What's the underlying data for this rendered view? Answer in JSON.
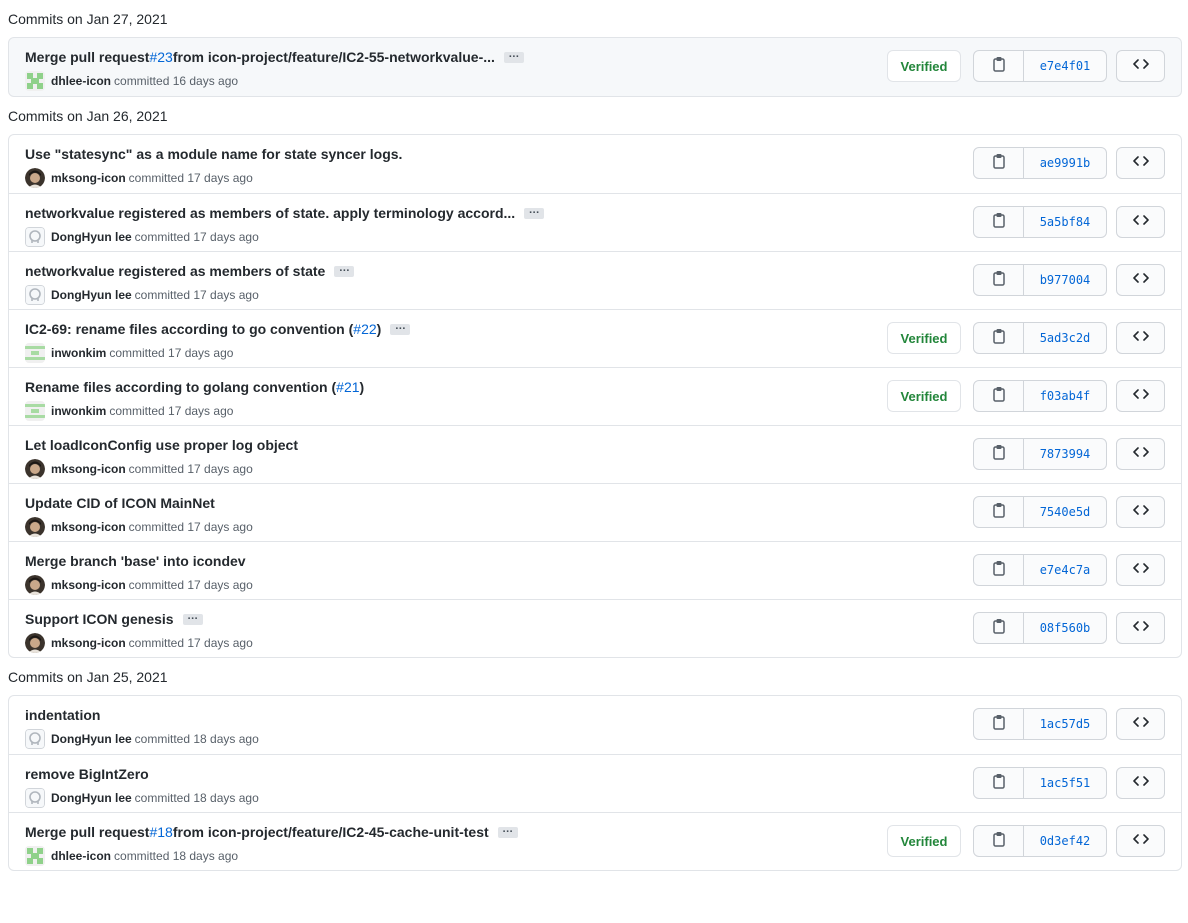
{
  "groups": [
    {
      "title": "Commits on Jan 27, 2021",
      "highlight": true,
      "commits": [
        {
          "pre": "Merge pull request ",
          "link": "#23",
          "post": " from icon-project/feature/IC2-55-networkvalue-...",
          "ellipsis": true,
          "author": "dhlee-icon",
          "avatar": "identicon-green",
          "time": "committed 16 days ago",
          "verified": true,
          "sha": "e7e4f01"
        }
      ]
    },
    {
      "title": "Commits on Jan 26, 2021",
      "highlight": false,
      "commits": [
        {
          "pre": "Use \"statesync\" as a module name for state syncer logs.",
          "link": "",
          "post": "",
          "ellipsis": false,
          "author": "mksong-icon",
          "avatar": "photo",
          "time": "committed 17 days ago",
          "verified": false,
          "sha": "ae9991b"
        },
        {
          "pre": "networkvalue registered as members of state. apply terminology accord...",
          "link": "",
          "post": "",
          "ellipsis": true,
          "author": "DongHyun lee",
          "avatar": "default",
          "time": "committed 17 days ago",
          "verified": false,
          "sha": "5a5bf84"
        },
        {
          "pre": "networkvalue registered as members of state",
          "link": "",
          "post": "",
          "ellipsis": true,
          "author": "DongHyun lee",
          "avatar": "default",
          "time": "committed 17 days ago",
          "verified": false,
          "sha": "b977004"
        },
        {
          "pre": "IC2-69: rename files according to go convention (",
          "link": "#22",
          "post": ")",
          "ellipsis": true,
          "author": "inwonkim",
          "avatar": "identicon-stripe",
          "time": "committed 17 days ago",
          "verified": true,
          "sha": "5ad3c2d"
        },
        {
          "pre": "Rename files according to golang convention (",
          "link": "#21",
          "post": ")",
          "ellipsis": false,
          "author": "inwonkim",
          "avatar": "identicon-stripe",
          "time": "committed 17 days ago",
          "verified": true,
          "sha": "f03ab4f"
        },
        {
          "pre": "Let loadIconConfig use proper log object",
          "link": "",
          "post": "",
          "ellipsis": false,
          "author": "mksong-icon",
          "avatar": "photo",
          "time": "committed 17 days ago",
          "verified": false,
          "sha": "7873994"
        },
        {
          "pre": "Update CID of ICON MainNet",
          "link": "",
          "post": "",
          "ellipsis": false,
          "author": "mksong-icon",
          "avatar": "photo",
          "time": "committed 17 days ago",
          "verified": false,
          "sha": "7540e5d"
        },
        {
          "pre": "Merge branch 'base' into icondev",
          "link": "",
          "post": "",
          "ellipsis": false,
          "author": "mksong-icon",
          "avatar": "photo",
          "time": "committed 17 days ago",
          "verified": false,
          "sha": "e7e4c7a"
        },
        {
          "pre": "Support ICON genesis",
          "link": "",
          "post": "",
          "ellipsis": true,
          "author": "mksong-icon",
          "avatar": "photo",
          "time": "committed 17 days ago",
          "verified": false,
          "sha": "08f560b"
        }
      ]
    },
    {
      "title": "Commits on Jan 25, 2021",
      "highlight": false,
      "commits": [
        {
          "pre": "indentation",
          "link": "",
          "post": "",
          "ellipsis": false,
          "author": "DongHyun lee",
          "avatar": "default",
          "time": "committed 18 days ago",
          "verified": false,
          "sha": "1ac57d5"
        },
        {
          "pre": "remove BigIntZero",
          "link": "",
          "post": "",
          "ellipsis": false,
          "author": "DongHyun lee",
          "avatar": "default",
          "time": "committed 18 days ago",
          "verified": false,
          "sha": "1ac5f51"
        },
        {
          "pre": "Merge pull request ",
          "link": "#18",
          "post": " from icon-project/feature/IC2-45-cache-unit-test",
          "ellipsis": true,
          "author": "dhlee-icon",
          "avatar": "identicon-green",
          "time": "committed 18 days ago",
          "verified": true,
          "sha": "0d3ef42"
        }
      ]
    }
  ],
  "labels": {
    "verified": "Verified",
    "ellipsis": "…"
  },
  "icons": {
    "copy": "clippy-icon",
    "browse": "code-icon"
  },
  "colors": {
    "link": "#0366d6",
    "verified": "#22863a",
    "border": "#e1e4e8"
  }
}
